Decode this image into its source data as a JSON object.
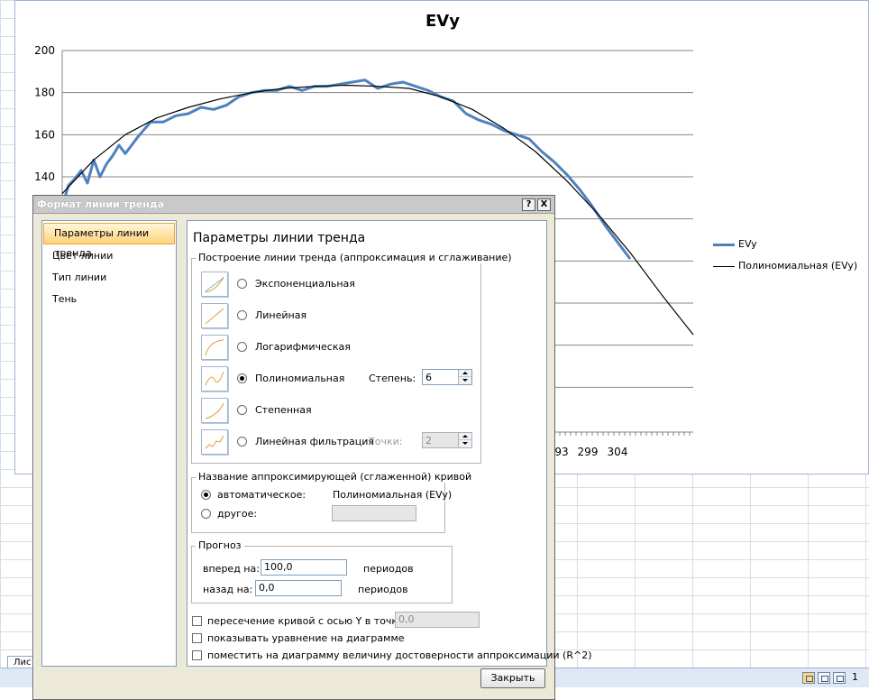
{
  "chart": {
    "title": "EVy",
    "y_ticks": [
      "200",
      "180",
      "160",
      "140"
    ],
    "x_ticks": [
      "93",
      "299",
      "304"
    ],
    "legend": [
      {
        "label": "EVy",
        "color": "#4f81bd"
      },
      {
        "label": "Полиномиальная (EVy)",
        "color": "#000000"
      }
    ]
  },
  "chart_data": {
    "type": "line",
    "title": "EVy",
    "ylim": [
      120,
      200
    ],
    "xlim": [
      0,
      100
    ],
    "grid": true,
    "legend_position": "right",
    "series": [
      {
        "name": "EVy",
        "color": "#4f81bd",
        "x": [
          0,
          1,
          2,
          3,
          4,
          5,
          6,
          7,
          8,
          9,
          10,
          12,
          14,
          16,
          18,
          20,
          22,
          24,
          26,
          28,
          30,
          32,
          34,
          36,
          38,
          40,
          42,
          44,
          46,
          48,
          50,
          52,
          54,
          56,
          58,
          60,
          62,
          64,
          66,
          68,
          70,
          72,
          74,
          76,
          78,
          80,
          82,
          84,
          86,
          88,
          90
        ],
        "values": [
          126,
          136,
          139,
          143,
          137,
          148,
          140,
          146,
          150,
          155,
          151,
          159,
          166,
          166,
          169,
          170,
          173,
          172,
          174,
          178,
          180,
          181,
          181,
          183,
          181,
          183,
          183,
          184,
          185,
          186,
          182,
          184,
          185,
          183,
          181,
          178,
          176,
          170,
          167,
          165,
          162,
          160,
          158,
          152,
          147,
          141,
          134,
          126,
          117,
          109,
          101
        ]
      },
      {
        "name": "Полиномиальная (EVy)",
        "color": "#000000",
        "x": [
          0,
          5,
          10,
          15,
          20,
          25,
          30,
          35,
          40,
          45,
          50,
          55,
          60,
          65,
          70,
          75,
          80,
          85,
          90,
          95,
          100
        ],
        "values": [
          132,
          148,
          160,
          168,
          173,
          177,
          180,
          182,
          183,
          183.5,
          183,
          182,
          178,
          172,
          163,
          152,
          138,
          122,
          104,
          84,
          65
        ]
      }
    ]
  },
  "dialog": {
    "title": "Формат линии тренда",
    "help_btn": "?",
    "close_btn": "X",
    "nav": [
      "Параметры линии тренда",
      "Цвет линии",
      "Тип линии",
      "Тень"
    ],
    "panel_title": "Параметры линии тренда",
    "group_type_title": "Построение линии тренда (аппроксимация и сглаживание)",
    "types": [
      "Экспоненциальная",
      "Линейная",
      "Логарифмическая",
      "Полиномиальная",
      "Степенная",
      "Линейная фильтрация"
    ],
    "selected_type": "Полиномиальная",
    "degree_label": "Степень:",
    "degree_value": "6",
    "points_label": "Точки:",
    "points_value": "2",
    "name_group_title": "Название аппроксимирующей (сглаженной) кривой",
    "name_auto_label": "автоматическое:",
    "name_auto_value": "Полиномиальная (EVy)",
    "name_other_label": "другое:",
    "forecast_title": "Прогноз",
    "forward_label": "вперед на:",
    "forward_value": "100,0",
    "backward_label": "назад на:",
    "backward_value": "0,0",
    "periods_label": "периодов",
    "intercept_label": "пересечение кривой с осью Y в точке:",
    "intercept_value": "0,0",
    "show_equation_label": "показывать уравнение на диаграмме",
    "show_r2_label": "поместить на диаграмму величину достоверности аппроксимации (R^2)",
    "close_label": "Закрыть"
  },
  "status": {
    "sheet_tab": "Лис",
    "zoom": "1"
  }
}
